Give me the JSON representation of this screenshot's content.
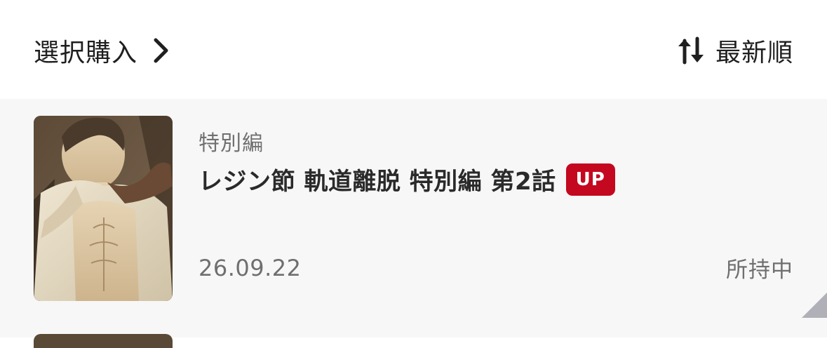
{
  "header": {
    "select_buy_label": "選択購入",
    "sort_label": "最新順",
    "select_buy_chevron_icon": "chevron-right-icon",
    "sort_icon": "sort-up-down-icon"
  },
  "episodes": [
    {
      "category": "特別編",
      "title": "レジン節 軌道離脱 特別編 第2話",
      "badge": "UP",
      "date": "26.09.22",
      "status": "所持中",
      "badge_color": "#c4081f"
    }
  ]
}
